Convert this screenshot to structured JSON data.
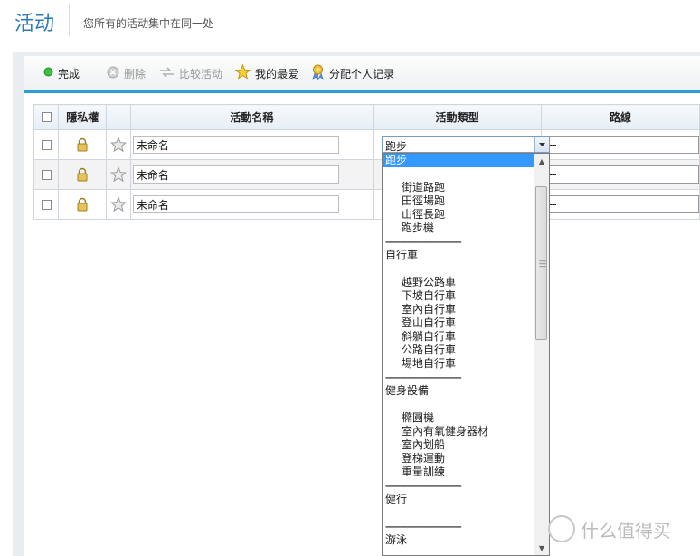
{
  "header": {
    "title": "活动",
    "subtitle": "您所有的活动集中在同一处"
  },
  "toolbar": {
    "done_label": "完成",
    "delete_label": "删除",
    "compare_label": "比较活动",
    "favorites_label": "我的最爱",
    "assign_label": "分配个人记录"
  },
  "table": {
    "columns": {
      "privacy": "隱私權",
      "name": "活動名稱",
      "type": "活動類型",
      "route": "路線"
    },
    "rows": [
      {
        "name": "未命名",
        "route": "--"
      },
      {
        "name": "未命名",
        "route": "--"
      },
      {
        "name": "未命名",
        "route": "--"
      }
    ]
  },
  "type_select": {
    "value": "跑步",
    "options": [
      {
        "label": "跑步",
        "kind": "selected"
      },
      {
        "label": "",
        "kind": "blank"
      },
      {
        "label": "街道路跑",
        "kind": "sub"
      },
      {
        "label": "田徑場跑",
        "kind": "sub"
      },
      {
        "label": "山徑長跑",
        "kind": "sub"
      },
      {
        "label": "跑步機",
        "kind": "sub"
      },
      {
        "label": "------------------------------------",
        "kind": "sep"
      },
      {
        "label": "自行車",
        "kind": "group"
      },
      {
        "label": "",
        "kind": "blank"
      },
      {
        "label": "越野公路車",
        "kind": "sub"
      },
      {
        "label": "下坡自行車",
        "kind": "sub"
      },
      {
        "label": "室內自行車",
        "kind": "sub"
      },
      {
        "label": "登山自行車",
        "kind": "sub"
      },
      {
        "label": "斜躺自行車",
        "kind": "sub"
      },
      {
        "label": "公路自行車",
        "kind": "sub"
      },
      {
        "label": "場地自行車",
        "kind": "sub"
      },
      {
        "label": "------------------------------------",
        "kind": "sep"
      },
      {
        "label": "健身設備",
        "kind": "group"
      },
      {
        "label": "",
        "kind": "blank"
      },
      {
        "label": "橢圓機",
        "kind": "sub"
      },
      {
        "label": "室內有氧健身器材",
        "kind": "sub"
      },
      {
        "label": "室內划船",
        "kind": "sub"
      },
      {
        "label": "登梯運動",
        "kind": "sub"
      },
      {
        "label": "重量訓練",
        "kind": "sub"
      },
      {
        "label": "------------------------------------",
        "kind": "sep"
      },
      {
        "label": "健行",
        "kind": "group"
      },
      {
        "label": "",
        "kind": "blank"
      },
      {
        "label": "------------------------------------",
        "kind": "sep"
      },
      {
        "label": "游泳",
        "kind": "group"
      }
    ]
  },
  "watermark": {
    "text": "什么值得买"
  },
  "colors": {
    "accent": "#2b9fd6",
    "title": "#2f7bbd",
    "selected": "#3399ff",
    "lock": "#d9b34a",
    "done_dot": "#3fbf3f"
  }
}
